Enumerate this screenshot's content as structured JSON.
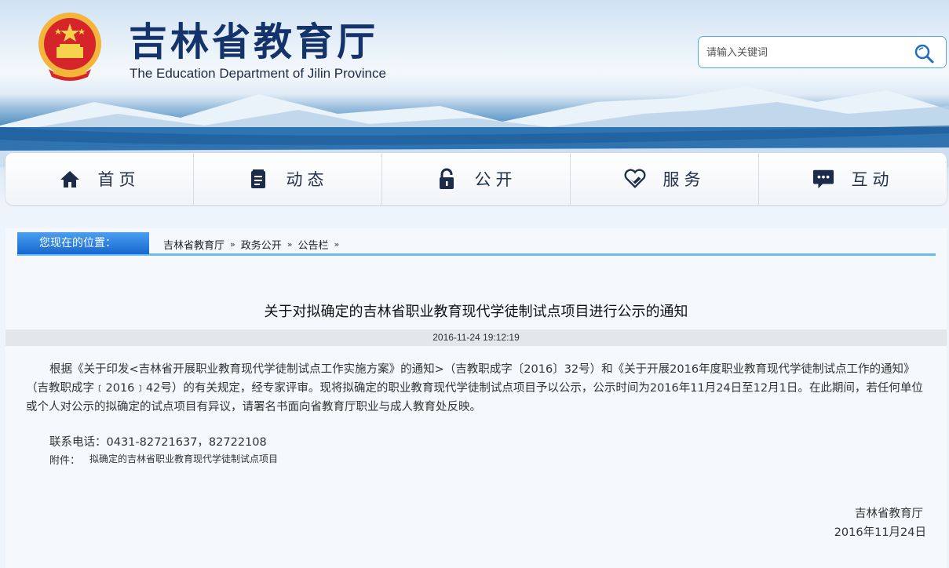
{
  "header": {
    "title": "吉林省教育厅",
    "subtitle": "The Education Department of Jilin Province",
    "search_placeholder": "请输入关键词"
  },
  "nav": [
    {
      "label": "首页",
      "icon": "home-icon"
    },
    {
      "label": "动态",
      "icon": "document-icon"
    },
    {
      "label": "公开",
      "icon": "lock-icon"
    },
    {
      "label": "服务",
      "icon": "handshake-heart-icon"
    },
    {
      "label": "互动",
      "icon": "chat-icon"
    }
  ],
  "breadcrumb": {
    "label": "您现在的位置：",
    "items": [
      "吉林省教育厅",
      "政务公开",
      "公告栏"
    ]
  },
  "article": {
    "title": "关于对拟确定的吉林省职业教育现代学徒制试点项目进行公示的通知",
    "datetime": "2016-11-24 19:12:19",
    "body": "根据《关于印发<吉林省开展职业教育现代学徒制试点工作实施方案》的通知>（吉教职成字〔2016〕32号）和《关于开展2016年度职业教育现代学徒制试点工作的通知》（吉教职成字﹝2016﹞42号）的有关规定，经专家评审。现将拟确定的职业教育现代学徒制试点项目予以公示，公示时间为2016年11月24日至12月1日。在此期间，若任何单位或个人对公示的拟确定的试点项目有异议，请署名书面向省教育厅职业与成人教育处反映。",
    "contact": "联系电话：0431-82721637，82722108",
    "attachment_label": "附件：",
    "attachment_link": "拟确定的吉林省职业教育现代学徒制试点项目",
    "sign_org": "吉林省教育厅",
    "sign_date": "2016年11月24日"
  },
  "colors": {
    "title": "#14336b",
    "crumb_accent": "#1567cf",
    "crumb_underline": "#6bbbea"
  }
}
